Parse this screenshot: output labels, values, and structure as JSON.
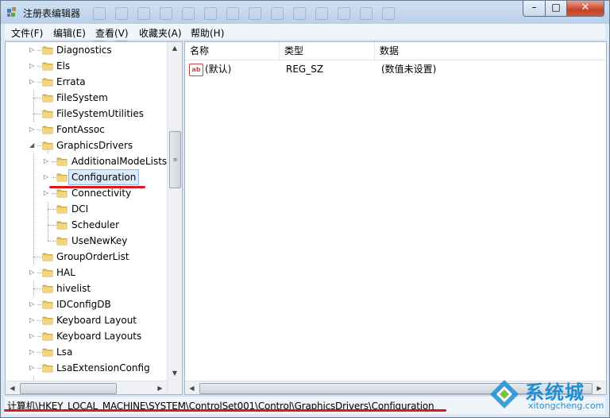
{
  "window": {
    "title": "注册表编辑器",
    "controls": {
      "minimize": "–",
      "maximize": "□",
      "close": "✕"
    }
  },
  "menu": [
    "文件(F)",
    "编辑(E)",
    "查看(V)",
    "收藏夹(A)",
    "帮助(H)"
  ],
  "tree": {
    "items": [
      {
        "label": "Diagnostics",
        "level": 1,
        "expander": "collapsed"
      },
      {
        "label": "Els",
        "level": 1,
        "expander": "collapsed"
      },
      {
        "label": "Errata",
        "level": 1,
        "expander": "collapsed"
      },
      {
        "label": "FileSystem",
        "level": 1,
        "expander": "none"
      },
      {
        "label": "FileSystemUtilities",
        "level": 1,
        "expander": "none"
      },
      {
        "label": "FontAssoc",
        "level": 1,
        "expander": "collapsed"
      },
      {
        "label": "GraphicsDrivers",
        "level": 1,
        "expander": "expanded"
      },
      {
        "label": "AdditionalModeLists",
        "level": 2,
        "expander": "collapsed"
      },
      {
        "label": "Configuration",
        "level": 2,
        "expander": "collapsed",
        "selected": true
      },
      {
        "label": "Connectivity",
        "level": 2,
        "expander": "collapsed"
      },
      {
        "label": "DCI",
        "level": 2,
        "expander": "none"
      },
      {
        "label": "Scheduler",
        "level": 2,
        "expander": "none"
      },
      {
        "label": "UseNewKey",
        "level": 2,
        "expander": "none"
      },
      {
        "label": "GroupOrderList",
        "level": 1,
        "expander": "none"
      },
      {
        "label": "HAL",
        "level": 1,
        "expander": "collapsed"
      },
      {
        "label": "hivelist",
        "level": 1,
        "expander": "none"
      },
      {
        "label": "IDConfigDB",
        "level": 1,
        "expander": "collapsed"
      },
      {
        "label": "Keyboard Layout",
        "level": 1,
        "expander": "collapsed"
      },
      {
        "label": "Keyboard Layouts",
        "level": 1,
        "expander": "collapsed"
      },
      {
        "label": "Lsa",
        "level": 1,
        "expander": "collapsed"
      },
      {
        "label": "LsaExtensionConfig",
        "level": 1,
        "expander": "collapsed"
      }
    ]
  },
  "values_list": {
    "columns": [
      "名称",
      "类型",
      "数据"
    ],
    "rows": [
      {
        "icon": "string-value-icon",
        "icon_text": "ab",
        "name": "(默认)",
        "type": "REG_SZ",
        "data": "(数值未设置)"
      }
    ]
  },
  "status_bar": {
    "path": "计算机\\HKEY_LOCAL_MACHINE\\SYSTEM\\ControlSet001\\Control\\GraphicsDrivers\\Configuration"
  },
  "watermark": {
    "title": "系统城",
    "site": "xitongcheng.com"
  },
  "colors": {
    "accent_blue": "#1f8fd6",
    "annotation_red": "#d81b1b",
    "selection": "#dcebfc"
  }
}
